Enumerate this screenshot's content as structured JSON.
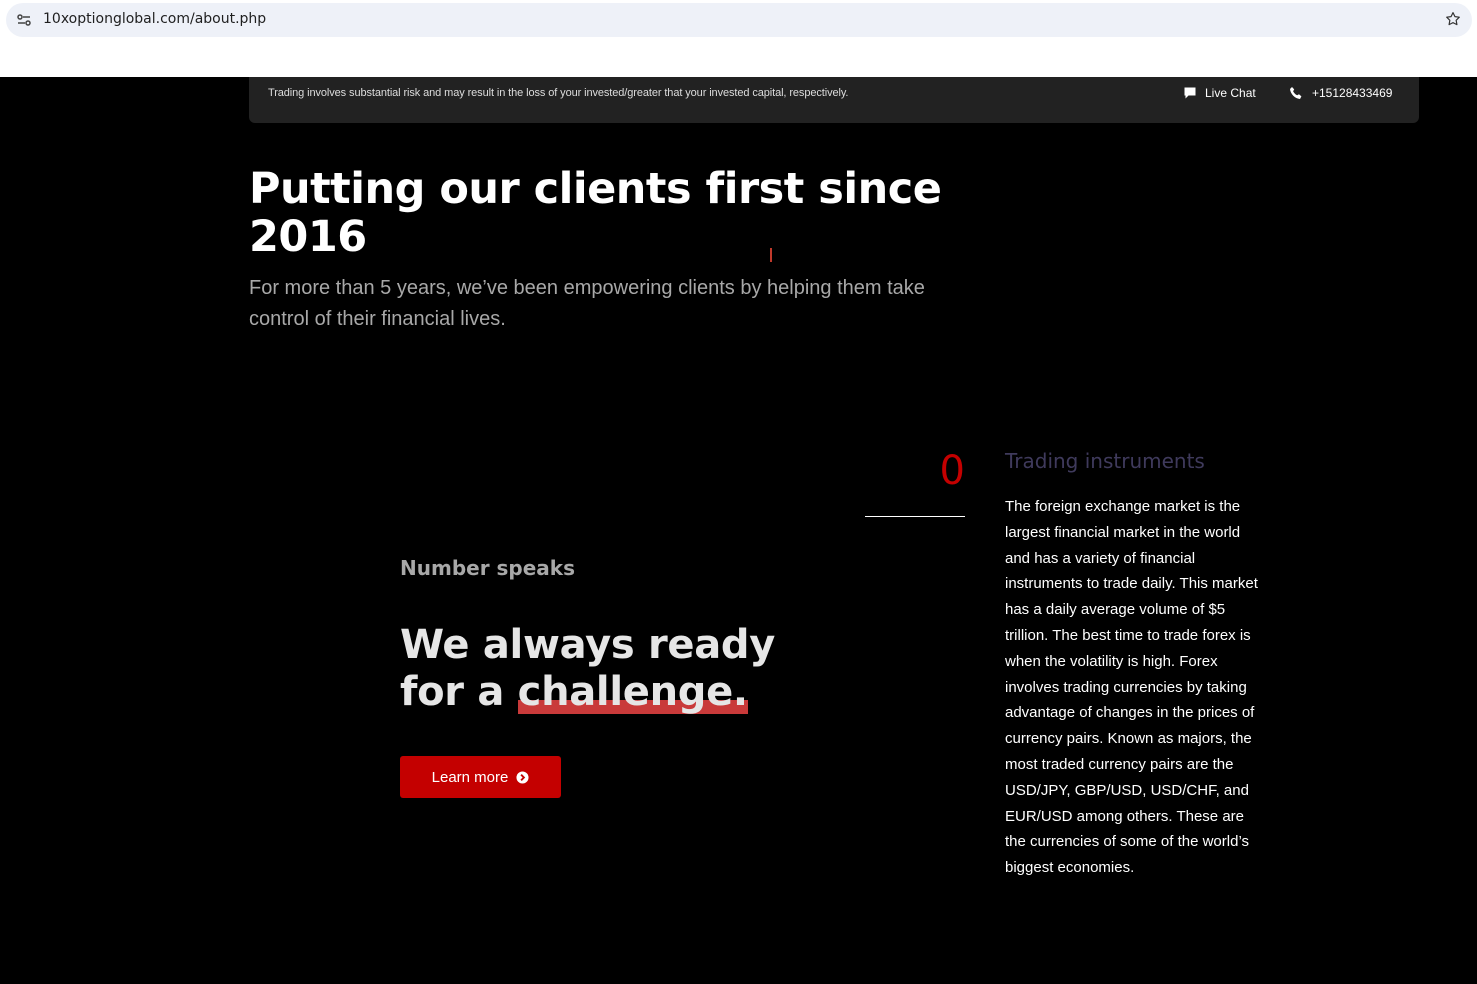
{
  "browser": {
    "url": "10xoptionglobal.com/about.php"
  },
  "topbar": {
    "risk_notice": "Trading involves substantial risk and may result in the loss of your invested/greater that your invested capital, respectively.",
    "live_chat": "Live Chat",
    "phone": "+15128433469"
  },
  "hero": {
    "title": "Putting our clients first since 2016",
    "subtitle": "For more than 5 years, we’ve been empowering clients by helping them take control of their financial lives."
  },
  "stats": {
    "counter": "0",
    "instruments_title": "Trading instruments",
    "instruments_text": "The foreign exchange market is the largest financial market in the world and has a variety of financial instruments to trade daily. This market has a daily average volume of $5 trillion. The best time to trade forex is when the volatility is high. Forex involves trading currencies by taking advantage of changes in the prices of currency pairs. Known as majors, the most traded currency pairs are the USD/JPY, GBP/USD, USD/CHF, and EUR/USD among others. These are the currencies of some of the world’s biggest economies."
  },
  "cta_section": {
    "eyebrow": "Number speaks",
    "headline_prefix": "We always ready for a ",
    "headline_highlight": "challenge.",
    "button_label": "Learn more"
  },
  "colors": {
    "accent": "#c40000",
    "background": "#000000",
    "topbar": "#222222"
  }
}
